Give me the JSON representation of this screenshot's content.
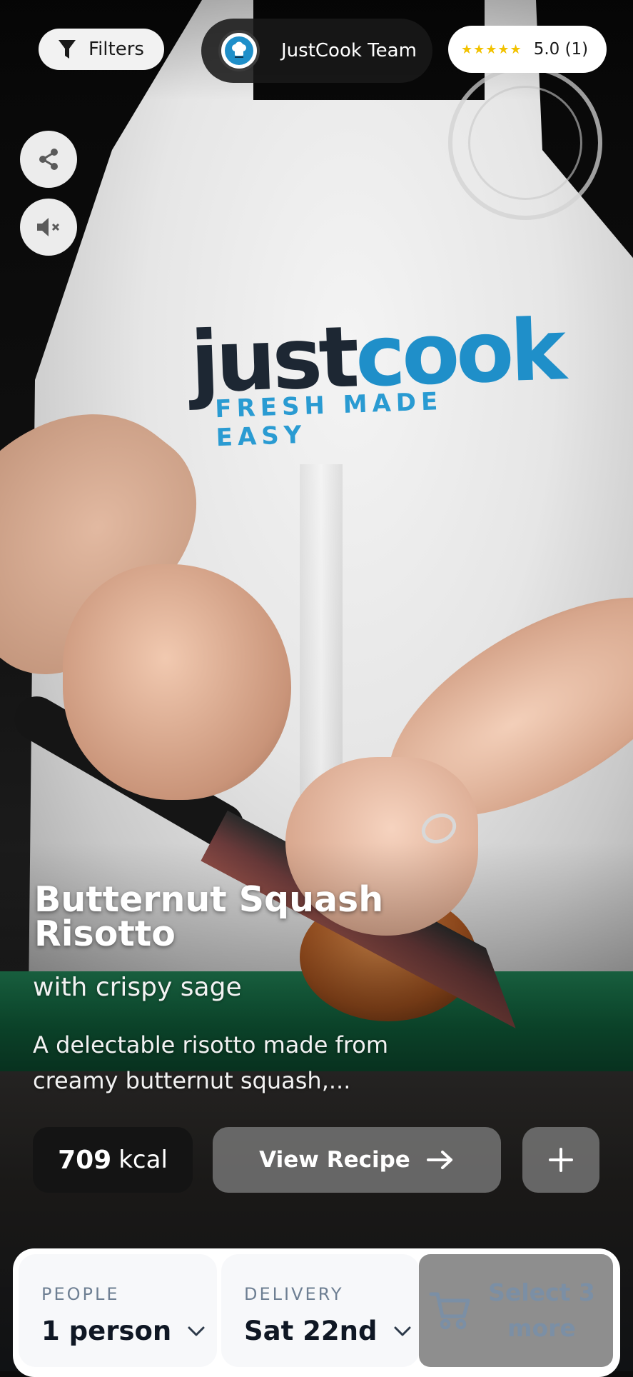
{
  "header": {
    "filters_label": "Filters",
    "team_name": "JustCook Team",
    "rating_stars": "★★★★★",
    "rating_text": "5.0 (1)"
  },
  "video": {
    "logo_just": "just",
    "logo_cook": "cook",
    "logo_tagline": "FRESH MADE EASY"
  },
  "recipe": {
    "title": "Butternut Squash Risotto",
    "subtitle": "with crispy sage",
    "description": "A delectable risotto made from creamy butternut squash,...",
    "kcal_value": "709",
    "kcal_unit": "kcal",
    "view_label": "View Recipe"
  },
  "order": {
    "people_label": "PEOPLE",
    "people_value": "1 person",
    "delivery_label": "DELIVERY",
    "delivery_value": "Sat 22nd",
    "select_label": "Select 3 more"
  },
  "icons": [
    "filter-icon",
    "chef-avatar-icon",
    "share-icon",
    "mute-icon",
    "arrow-right-icon",
    "plus-icon",
    "chevron-down-icon",
    "cart-icon"
  ],
  "colors": {
    "brand_blue": "#1f8fc9",
    "star_yellow": "#f2c200",
    "label_gray": "#6e7f93",
    "select_disabled_bg": "#8e8e8e"
  }
}
